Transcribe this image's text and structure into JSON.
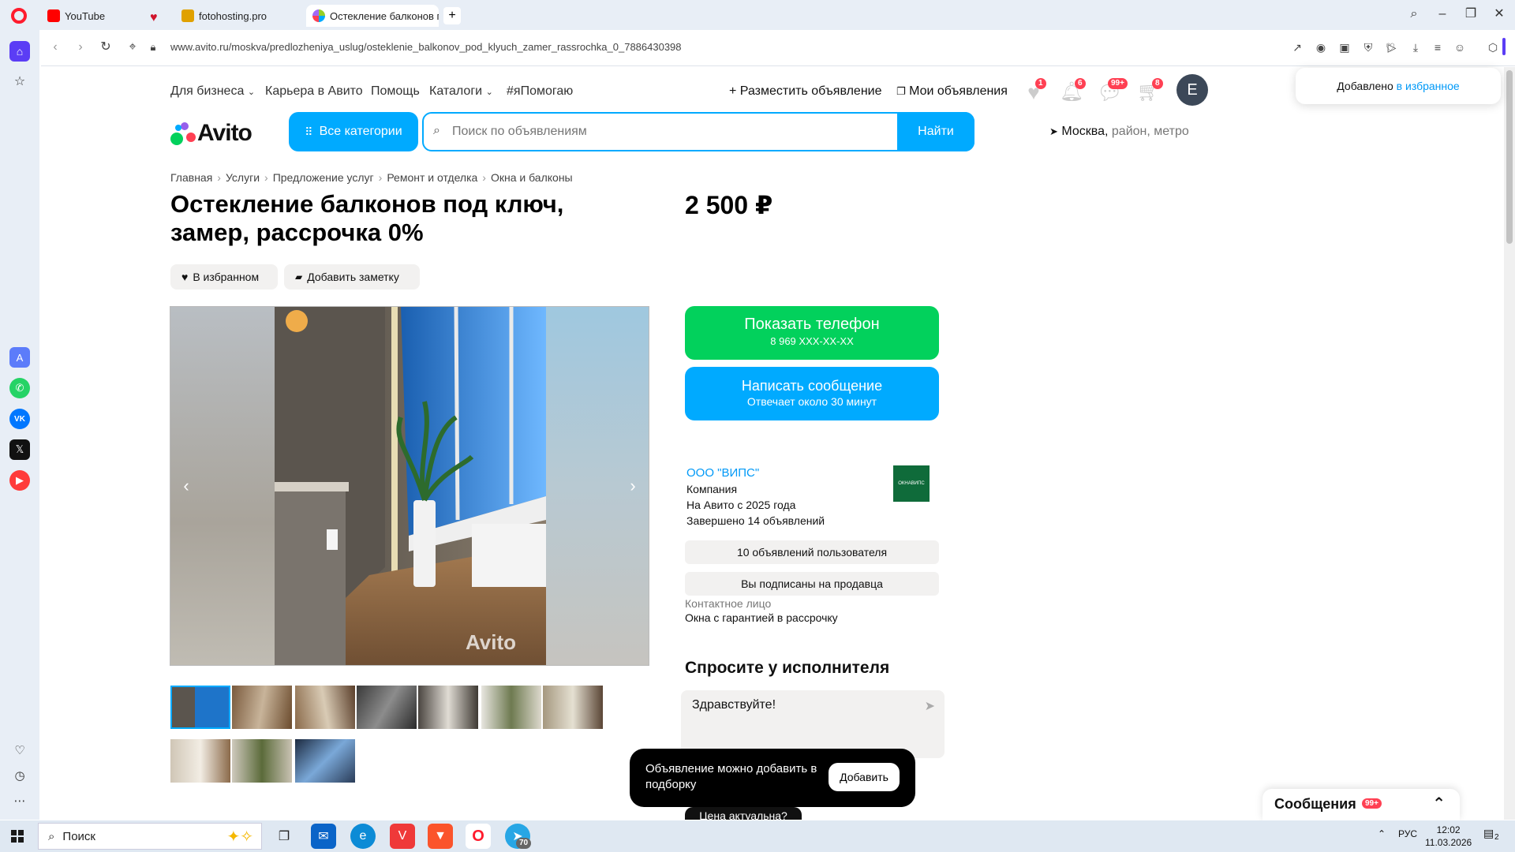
{
  "browser": {
    "tabs": [
      {
        "label": "YouTube",
        "favicon_color": "#ff0000"
      },
      {
        "label": "fotohosting.pro",
        "favicon_color": "#e0a100"
      },
      {
        "label": "Остекление балконов по",
        "favicon_color": "#97cf26"
      }
    ],
    "url": "www.avito.ru/moskva/predlozheniya_uslug/osteklenie_balkonov_pod_klyuch_zamer_rassrochka_0_7886430398"
  },
  "topnav": {
    "business": "Для бизнеса",
    "career": "Карьера в Авито",
    "help": "Помощь",
    "catalogs": "Каталоги",
    "help_tag": "#яПомогаю",
    "post_ad": "Разместить объявление",
    "my_ads": "Мои объявления",
    "badges": {
      "favorites": "1",
      "notifications": "6",
      "messages": "99+",
      "cart": "8"
    },
    "avatar_letter": "E"
  },
  "header": {
    "logo": "Avito",
    "categories_button": "Все категории",
    "search_placeholder": "Поиск по объявлениям",
    "find_button": "Найти",
    "location_city": "Москва,",
    "location_hint": "район, метро"
  },
  "breadcrumbs": [
    "Главная",
    "Услуги",
    "Предложение услуг",
    "Ремонт и отделка",
    "Окна и балконы"
  ],
  "listing": {
    "title": "Остекление балконов под ключ, замер, рассрочка 0%",
    "price": "2 500 ₽",
    "fav_button": "В избранном",
    "note_button": "Добавить заметку",
    "watermark": "Avito"
  },
  "actions": {
    "show_phone": "Показать телефон",
    "phone_masked": "8 969 XXX-XX-XX",
    "write_message": "Написать сообщение",
    "reply_time": "Отвечает около 30 минут"
  },
  "seller": {
    "name": "ООО \"ВИПС\"",
    "type": "Компания",
    "since": "На Авито с 2025 года",
    "completed": "Завершено 14 объявлений",
    "logo_text": "ОКНАВИПС",
    "user_ads": "10 объявлений пользователя",
    "subscribed": "Вы подписаны на продавца",
    "contact_label": "Контактное лицо",
    "contact_value": "Окна с гарантией в рассрочку"
  },
  "ask": {
    "title": "Спросите у исполнителя",
    "message": "Здравствуйте!",
    "price_actual": "Цена актуальна?"
  },
  "toast": {
    "text": "Объявление можно добавить в подборку",
    "button": "Добавить"
  },
  "fav_toast": {
    "text": "Добавлено",
    "link": "в избранное"
  },
  "messages_panel": {
    "label": "Сообщения",
    "badge": "99+"
  },
  "taskbar": {
    "search": "Поиск",
    "lang": "РУС",
    "time": "12:02",
    "date": "11.03.2026",
    "telegram_badge": "70",
    "notif_count": "2"
  }
}
